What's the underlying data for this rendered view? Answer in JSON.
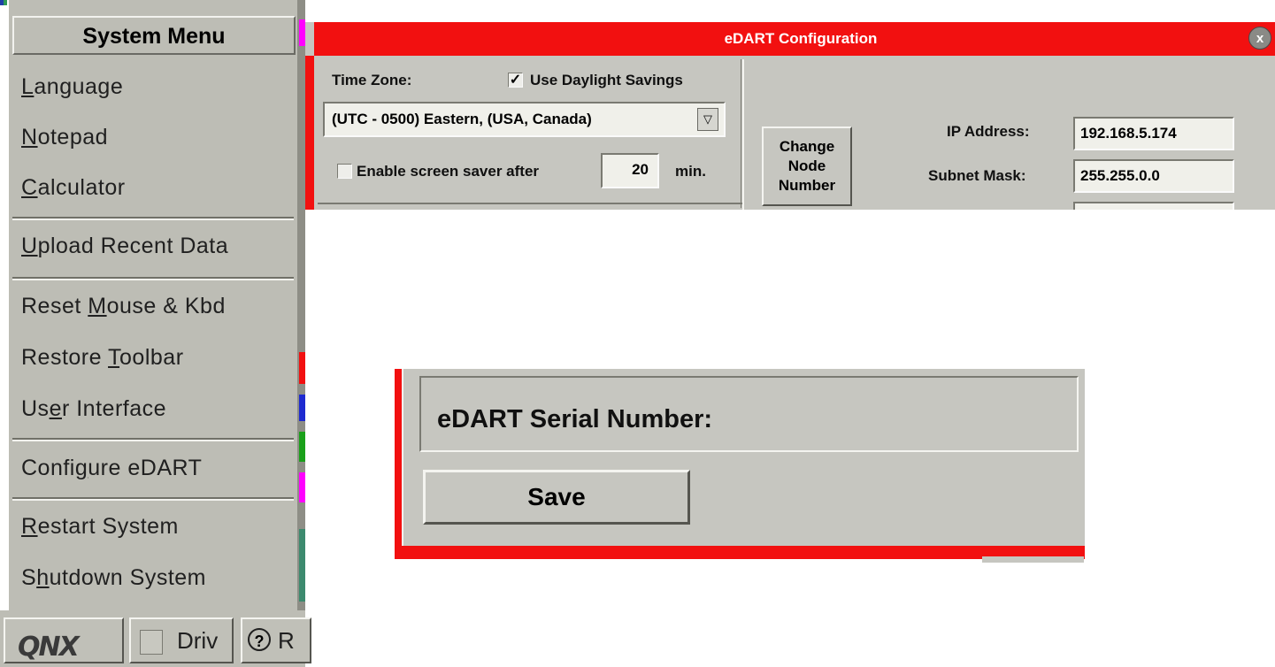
{
  "system_menu": {
    "title": "System Menu",
    "items": [
      {
        "pre": "",
        "u": "L",
        "post": "anguage"
      },
      {
        "pre": "",
        "u": "N",
        "post": "otepad"
      },
      {
        "pre": "",
        "u": "C",
        "post": "alculator"
      },
      {
        "pre": "",
        "u": "U",
        "post": "pload Recent Data"
      },
      {
        "pre": "Reset ",
        "u": "M",
        "post": "ouse & Kbd"
      },
      {
        "pre": "Restore ",
        "u": "T",
        "post": "oolbar"
      },
      {
        "pre": "Us",
        "u": "e",
        "post": "r Interface"
      },
      {
        "pre": "Confi",
        "u": "g",
        "post": "ure eDART"
      },
      {
        "pre": "",
        "u": "R",
        "post": "estart System"
      },
      {
        "pre": "S",
        "u": "h",
        "post": "utdown System"
      }
    ]
  },
  "taskbar": {
    "logo": "QNX",
    "driv_label": "Driv",
    "r_label": "R"
  },
  "edart_window": {
    "title": "eDART Configuration",
    "close_glyph": "x",
    "time_zone_label": "Time Zone:",
    "daylight_savings_label": "Use Daylight Savings",
    "daylight_savings_checked": true,
    "time_zone_value": "(UTC - 0500) Eastern, (USA, Canada)",
    "screensaver_label": "Enable screen saver after",
    "screensaver_checked": false,
    "screensaver_minutes": "20",
    "screensaver_unit": "min.",
    "change_node_button": [
      "Change",
      "Node",
      "Number"
    ],
    "ip_address_label": "IP Address:",
    "ip_address_value": "192.168.5.174",
    "subnet_mask_label": "Subnet Mask:",
    "subnet_mask_value": "255.255.0.0",
    "serial_number_label": "eDART Serial Number:",
    "save_button": "Save"
  },
  "colors": {
    "titlebar_red": "#f21010",
    "panel_gray": "#c6c6c0",
    "menu_gray": "#bdbdb5"
  }
}
